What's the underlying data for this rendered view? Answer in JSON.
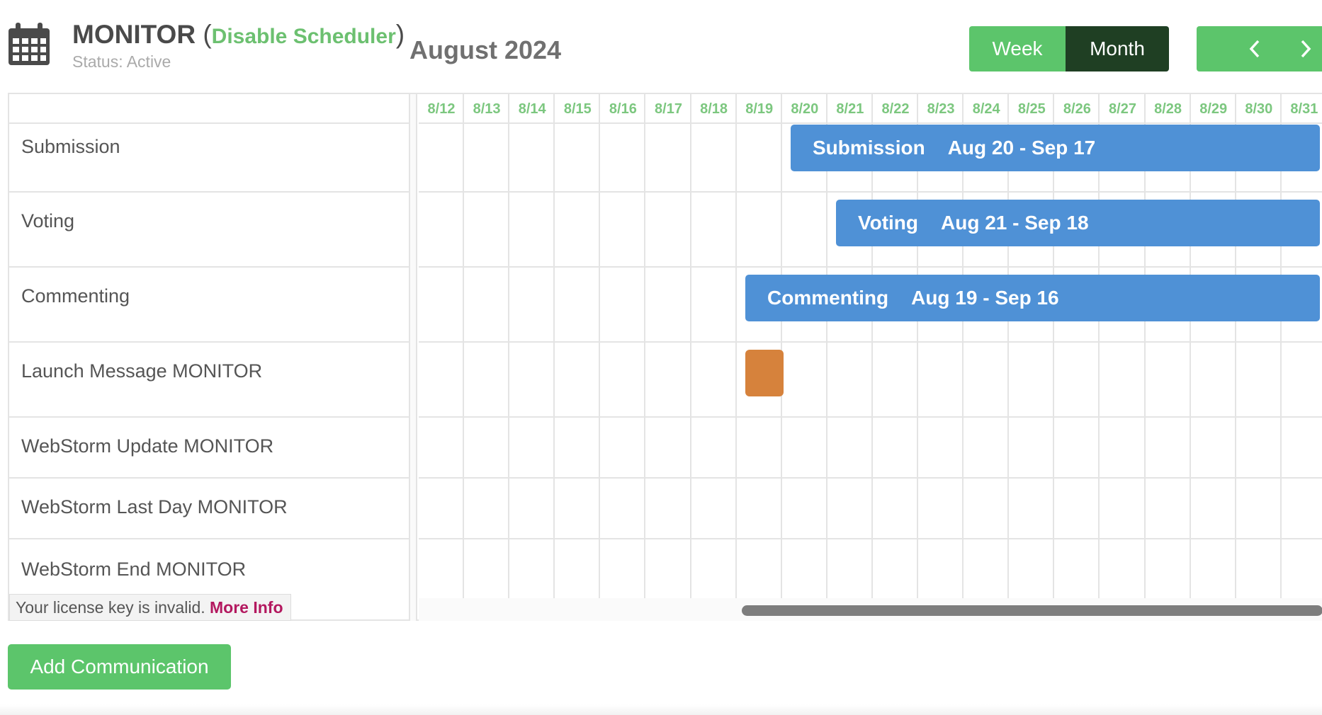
{
  "header": {
    "scheduler_name": "MONITOR",
    "paren_open": "(",
    "toggle_label": "Disable Scheduler",
    "paren_close": ")",
    "status": "Status: Active",
    "month_title": "August 2024",
    "view_week": "Week",
    "view_month": "Month",
    "prev_icon": "chevron-left-icon",
    "next_icon": "chevron-right-icon"
  },
  "days": [
    "8/12",
    "8/13",
    "8/14",
    "8/15",
    "8/16",
    "8/17",
    "8/18",
    "8/19",
    "8/20",
    "8/21",
    "8/22",
    "8/23",
    "8/24",
    "8/25",
    "8/26",
    "8/27",
    "8/28",
    "8/29",
    "8/30",
    "8/31"
  ],
  "resources": [
    "Submission",
    "Voting",
    "Commenting",
    "Launch Message MONITOR",
    "WebStorm Update MONITOR",
    "WebStorm Last Day MONITOR",
    "WebStorm End MONITOR"
  ],
  "events": [
    {
      "name": "Submission",
      "range": "Aug 20 - Sep 17"
    },
    {
      "name": "Voting",
      "range": "Aug 21 - Sep 18"
    },
    {
      "name": "Commenting",
      "range": "Aug 19 - Sep 16"
    }
  ],
  "license": {
    "text": "Your license key is invalid.",
    "link": "More Info"
  },
  "add_button": "Add Communication",
  "colors": {
    "green": "#5cc56b",
    "dark_green": "#1f3f23",
    "event_blue": "#4f91d6",
    "message_orange": "#d6823c",
    "link_pink": "#b3185f"
  }
}
